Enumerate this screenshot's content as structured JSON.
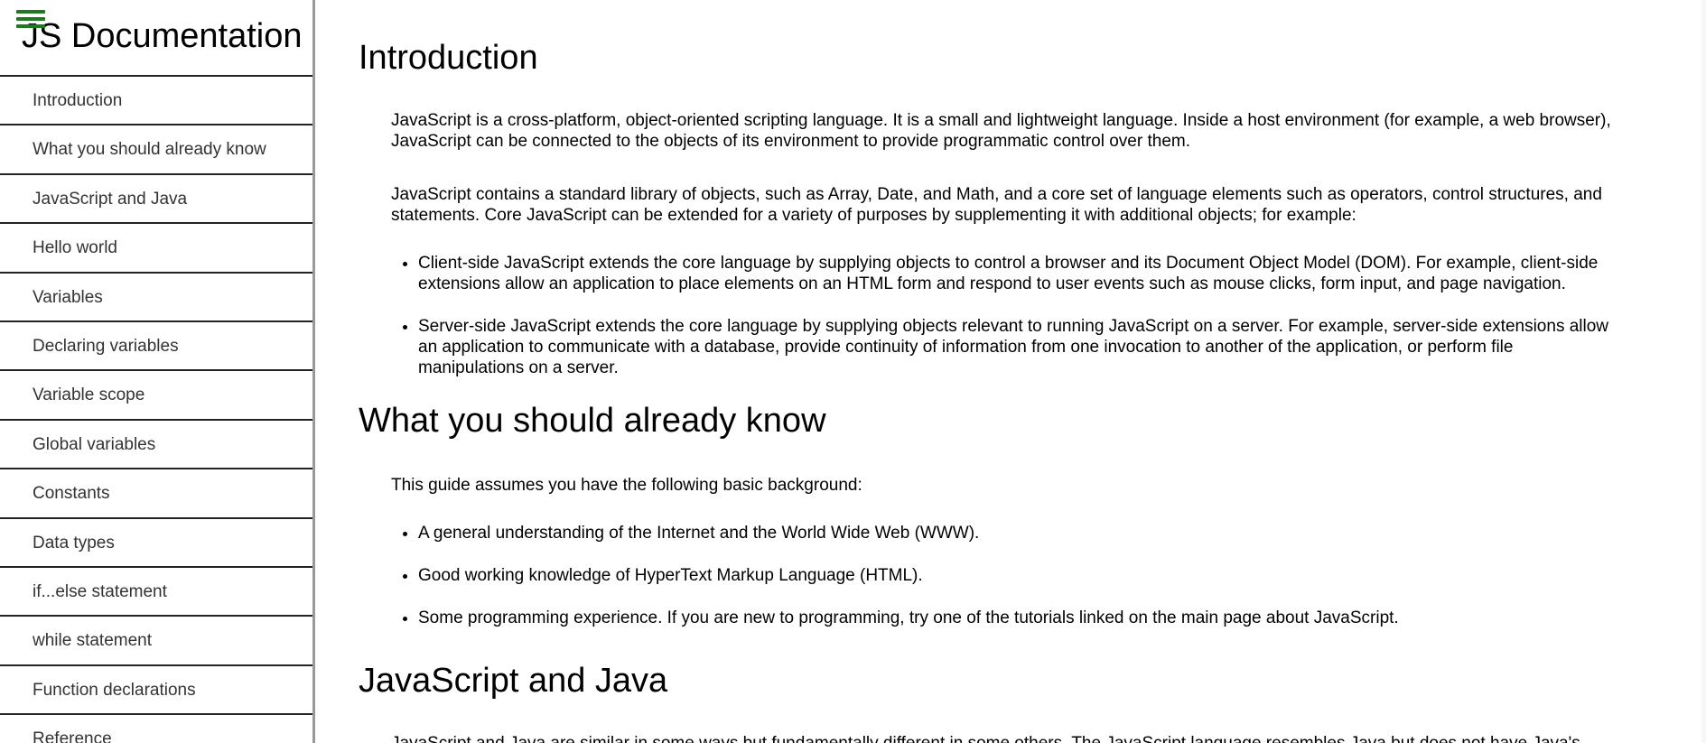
{
  "sidebar": {
    "title": "JS Documentation",
    "menu_icon": "hamburger-menu-icon",
    "items": [
      {
        "label": "Introduction"
      },
      {
        "label": "What you should already know"
      },
      {
        "label": "JavaScript and Java"
      },
      {
        "label": "Hello world"
      },
      {
        "label": "Variables"
      },
      {
        "label": "Declaring variables"
      },
      {
        "label": "Variable scope"
      },
      {
        "label": "Global variables"
      },
      {
        "label": "Constants"
      },
      {
        "label": "Data types"
      },
      {
        "label": "if...else statement"
      },
      {
        "label": "while statement"
      },
      {
        "label": "Function declarations"
      },
      {
        "label": "Reference"
      }
    ]
  },
  "main": {
    "sections": [
      {
        "heading": "Introduction",
        "paragraphs": [
          "JavaScript is a cross-platform, object-oriented scripting language. It is a small and lightweight language. Inside a host environment (for example, a web browser), JavaScript can be connected to the objects of its environment to provide programmatic control over them.",
          "JavaScript contains a standard library of objects, such as Array, Date, and Math, and a core set of language elements such as operators, control structures, and statements. Core JavaScript can be extended for a variety of purposes by supplementing it with additional objects; for example:"
        ],
        "bullets": [
          "Client-side JavaScript extends the core language by supplying objects to control a browser and its Document Object Model (DOM). For example, client-side extensions allow an application to place elements on an HTML form and respond to user events such as mouse clicks, form input, and page navigation.",
          "Server-side JavaScript extends the core language by supplying objects relevant to running JavaScript on a server. For example, server-side extensions allow an application to communicate with a database, provide continuity of information from one invocation to another of the application, or perform file manipulations on a server."
        ]
      },
      {
        "heading": "What you should already know",
        "paragraphs": [
          "This guide assumes you have the following basic background:"
        ],
        "bullets": [
          "A general understanding of the Internet and the World Wide Web (WWW).",
          "Good working knowledge of HyperText Markup Language (HTML).",
          "Some programming experience. If you are new to programming, try one of the tutorials linked on the main page about JavaScript."
        ]
      },
      {
        "heading": "JavaScript and Java",
        "paragraphs": [
          "JavaScript and Java are similar in some ways but fundamentally different in some others. The JavaScript language resembles Java but does not have Java's"
        ]
      }
    ]
  },
  "colors": {
    "menu_icon": "#1e7a1e",
    "sidebar_border": "#999999",
    "nav_divider": "#222222"
  }
}
